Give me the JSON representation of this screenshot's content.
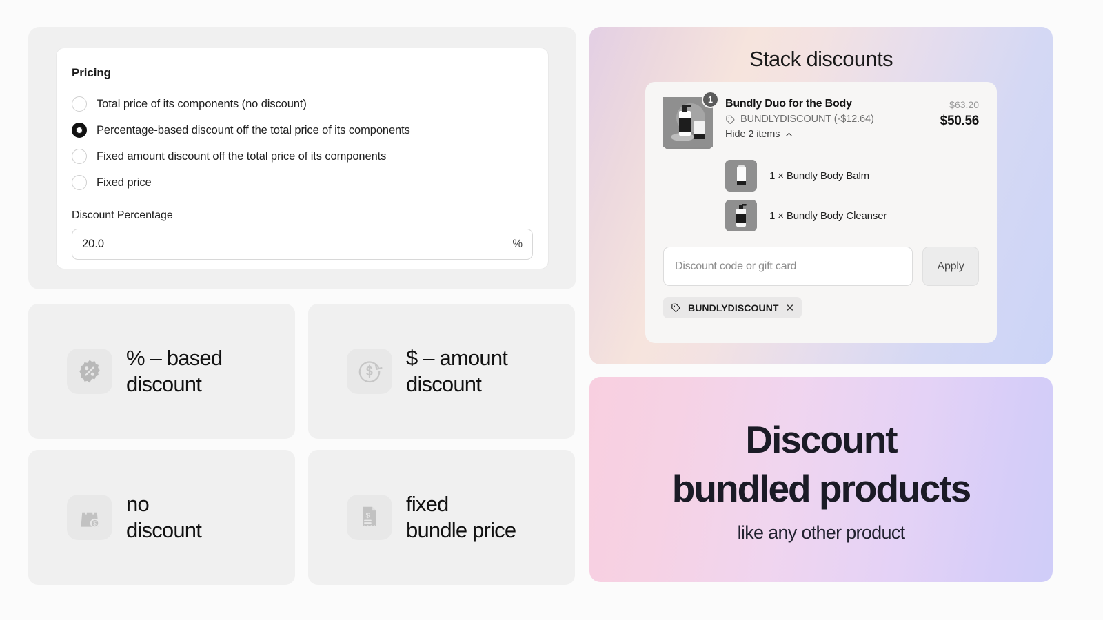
{
  "pricing": {
    "title": "Pricing",
    "options": [
      {
        "label": "Total price of its components (no discount)",
        "selected": false
      },
      {
        "label": "Percentage-based discount off the total price of its components",
        "selected": true
      },
      {
        "label": "Fixed amount discount off the total price of its components",
        "selected": false
      },
      {
        "label": "Fixed price",
        "selected": false
      }
    ],
    "field_label": "Discount Percentage",
    "field_value": "20.0",
    "field_suffix": "%"
  },
  "features": [
    {
      "icon": "percent-badge-icon",
      "text": "% – based\ndiscount"
    },
    {
      "icon": "dollar-refresh-icon",
      "text": "$ – amount\ndiscount"
    },
    {
      "icon": "shopping-bag-dollar-icon",
      "text": "no\ndiscount"
    },
    {
      "icon": "receipt-dollar-icon",
      "text": "fixed\nbundle price"
    }
  ],
  "stack": {
    "title": "Stack discounts",
    "cart": {
      "quantity_badge": "1",
      "product_name": "Bundly Duo for the Body",
      "discount_code": "BUNDLYDISCOUNT (-$12.64)",
      "toggle_label": "Hide 2 items",
      "price_original": "$63.20",
      "price_discounted": "$50.56",
      "sub_items": [
        {
          "label": "1 × Bundly Body Balm",
          "thumb": "body-balm-tube"
        },
        {
          "label": "1 × Bundly Body Cleanser",
          "thumb": "body-cleanser-bottle"
        }
      ],
      "code_placeholder": "Discount code or gift card",
      "apply_label": "Apply",
      "applied_chip": "BUNDLYDISCOUNT",
      "chip_remove": "✕"
    }
  },
  "promo": {
    "heading": "Discount\nbundled products",
    "subheading": "like any other product"
  },
  "colors": {
    "panel_gray": "#f0f0f0",
    "card_white": "#ffffff",
    "cart_card": "#f7f6f5",
    "text_dark": "#141414",
    "muted": "#6f6f6f",
    "stack_gradient_left": "#e3cfe4",
    "stack_gradient_mid": "#f6e4dd",
    "stack_gradient_right": "#ccd4f7",
    "promo_gradient_left": "#f8cfe0",
    "promo_gradient_right": "#cfcdf8"
  }
}
